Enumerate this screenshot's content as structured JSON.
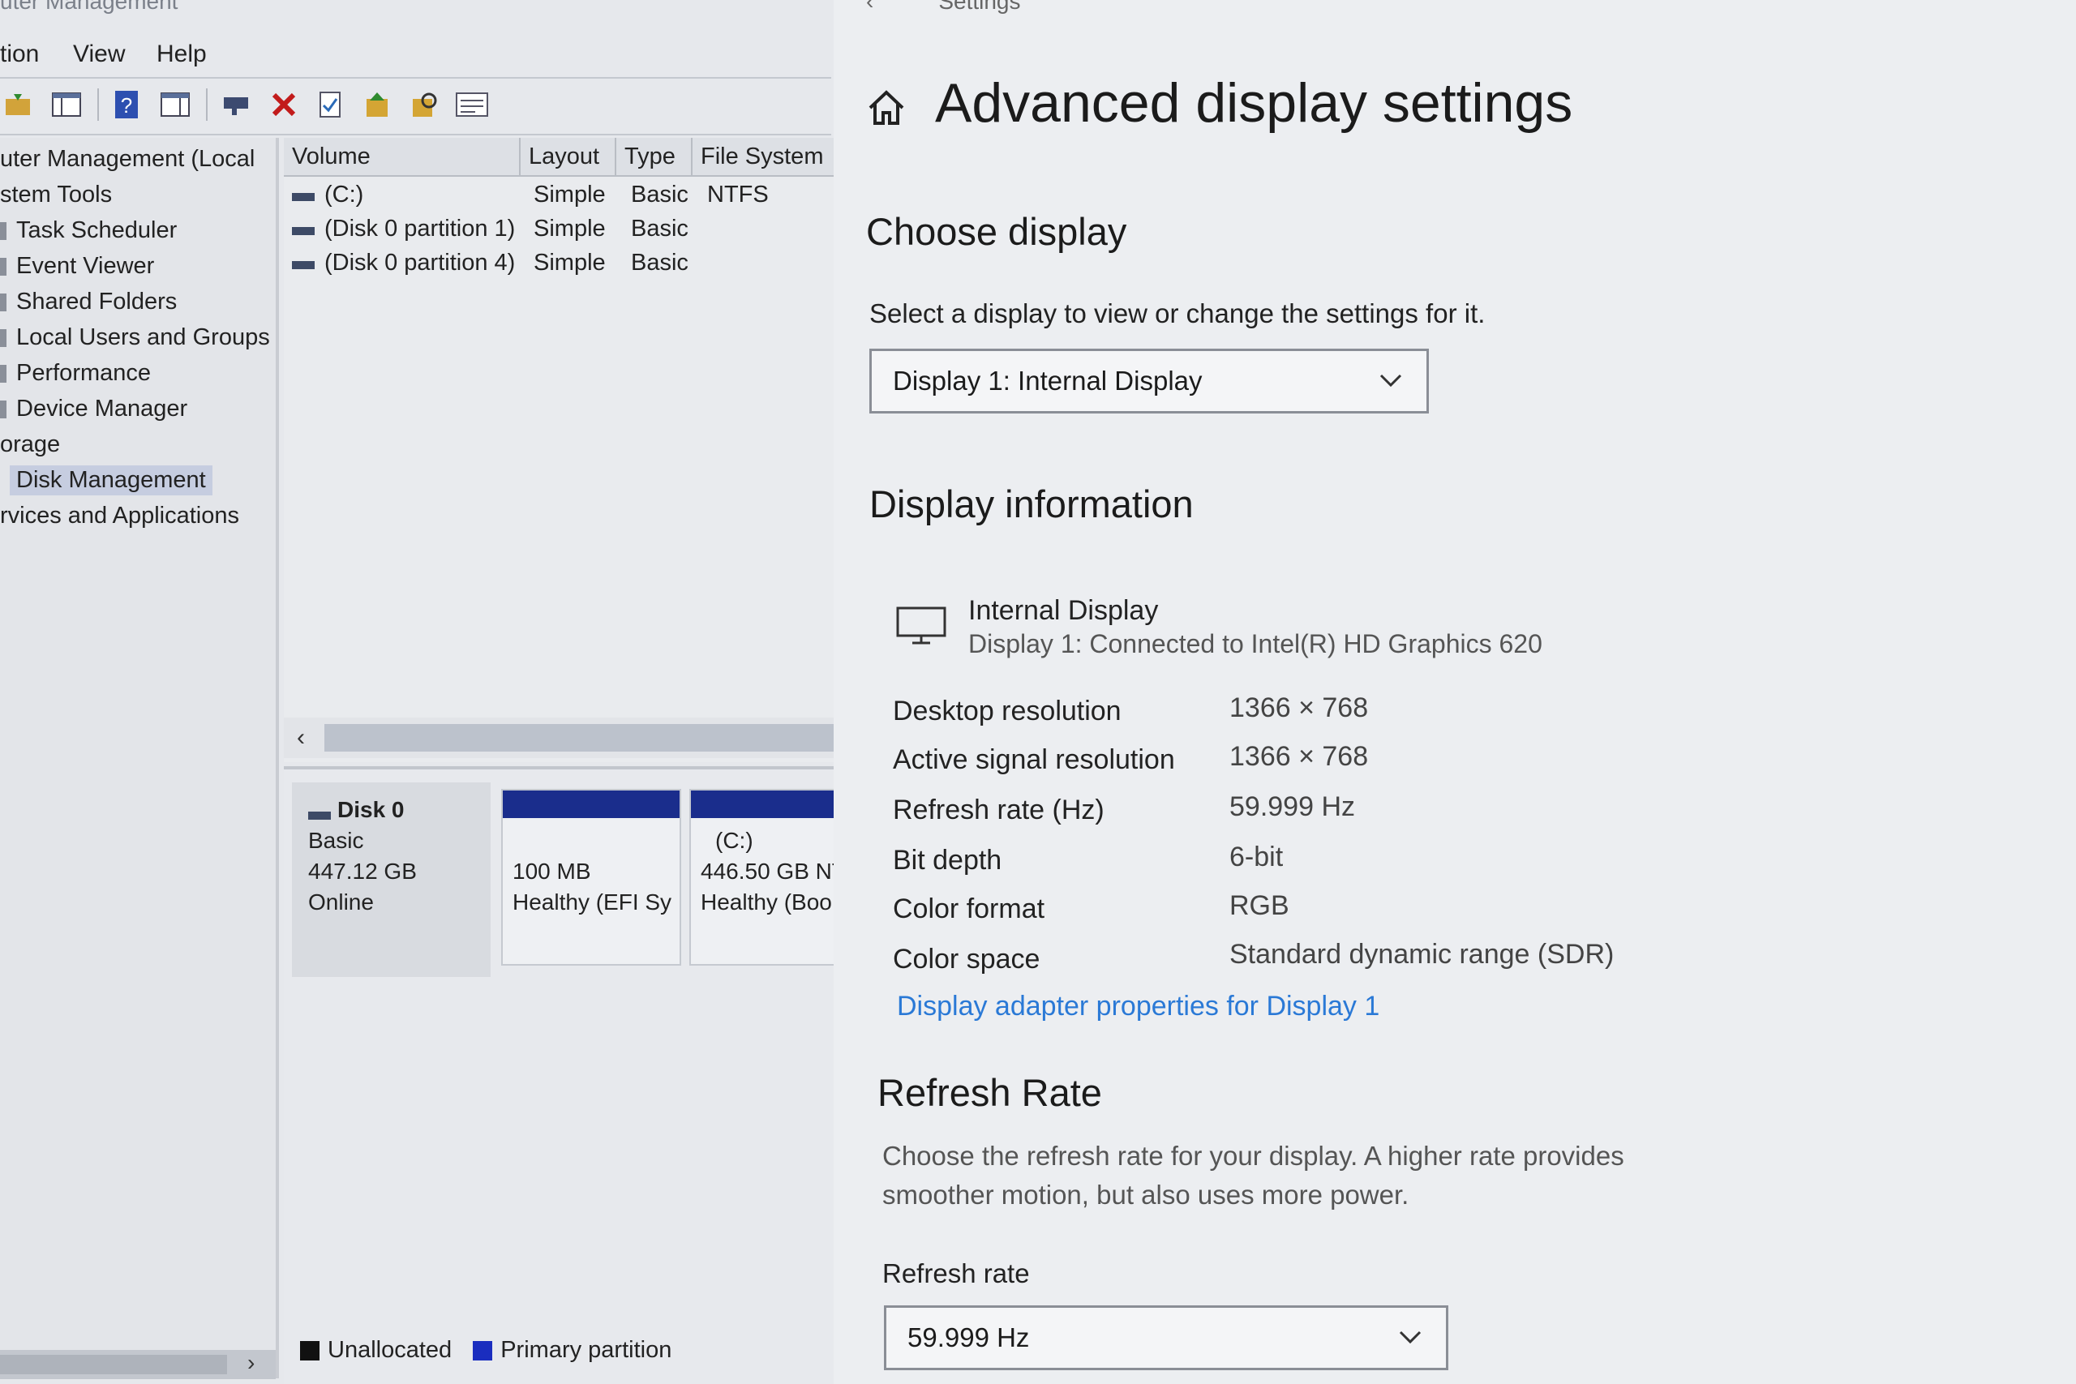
{
  "computer_management": {
    "title": "uter Management",
    "menu": [
      "tion",
      "View",
      "Help"
    ],
    "tree": [
      {
        "label": "uter Management (Local",
        "indent": 0
      },
      {
        "label": "stem Tools",
        "indent": 0
      },
      {
        "label": "Task Scheduler",
        "indent": 1
      },
      {
        "label": "Event Viewer",
        "indent": 1
      },
      {
        "label": "Shared Folders",
        "indent": 1
      },
      {
        "label": "Local Users and Groups",
        "indent": 1
      },
      {
        "label": "Performance",
        "indent": 1
      },
      {
        "label": "Device Manager",
        "indent": 1
      },
      {
        "label": "orage",
        "indent": 0
      },
      {
        "label": "Disk Management",
        "indent": 1,
        "selected": true
      },
      {
        "label": "rvices and Applications",
        "indent": 0
      }
    ],
    "columns": [
      "Volume",
      "Layout",
      "Type",
      "File System"
    ],
    "volumes": [
      {
        "volume": "(C:)",
        "layout": "Simple",
        "type": "Basic",
        "fs": "NTFS"
      },
      {
        "volume": "(Disk 0 partition 1)",
        "layout": "Simple",
        "type": "Basic",
        "fs": ""
      },
      {
        "volume": "(Disk 0 partition 4)",
        "layout": "Simple",
        "type": "Basic",
        "fs": ""
      }
    ],
    "disk": {
      "name": "Disk 0",
      "type": "Basic",
      "size": "447.12 GB",
      "status": "Online",
      "partitions": [
        {
          "title": "",
          "size": "100 MB",
          "status": "Healthy (EFI Sy"
        },
        {
          "title": "(C:)",
          "size": "446.50 GB NT",
          "status": "Healthy (Boo"
        }
      ]
    },
    "legend": [
      {
        "label": "Unallocated",
        "color": "#111111"
      },
      {
        "label": "Primary partition",
        "color": "#1a2dbf"
      }
    ]
  },
  "settings": {
    "topbar": "Settings",
    "title": "Advanced display settings",
    "choose_display": {
      "heading": "Choose display",
      "prompt": "Select a display to view or change the settings for it.",
      "selected": "Display 1: Internal Display"
    },
    "display_info": {
      "heading": "Display information",
      "name": "Internal Display",
      "subtitle": "Display 1: Connected to Intel(R) HD Graphics 620",
      "rows": [
        {
          "label": "Desktop resolution",
          "value": "1366 × 768"
        },
        {
          "label": "Active signal resolution",
          "value": "1366 × 768"
        },
        {
          "label": "Refresh rate (Hz)",
          "value": "59.999 Hz"
        },
        {
          "label": "Bit depth",
          "value": "6-bit"
        },
        {
          "label": "Color format",
          "value": "RGB"
        },
        {
          "label": "Color space",
          "value": "Standard dynamic range (SDR)"
        }
      ],
      "adapter_link": "Display adapter properties for Display 1"
    },
    "refresh": {
      "heading": "Refresh Rate",
      "description": "Choose the refresh rate for your display. A higher rate provides smoother motion, but also uses more power.",
      "label": "Refresh rate",
      "selected": "59.999 Hz"
    },
    "link_color": "#2a79d6"
  }
}
